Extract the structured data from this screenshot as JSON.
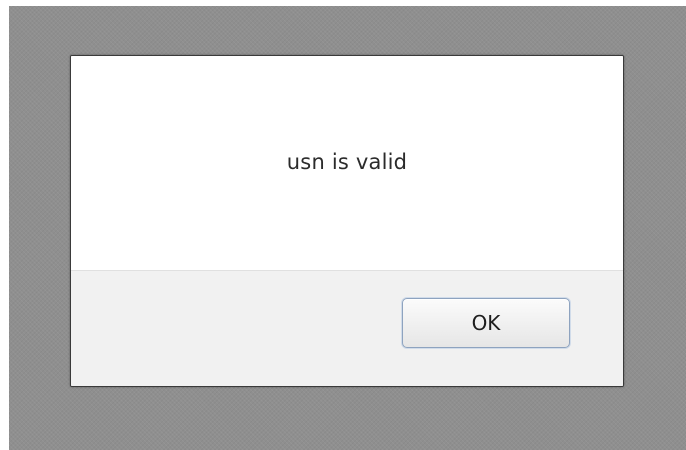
{
  "dialog": {
    "message": "usn is valid",
    "ok_label": "OK"
  }
}
